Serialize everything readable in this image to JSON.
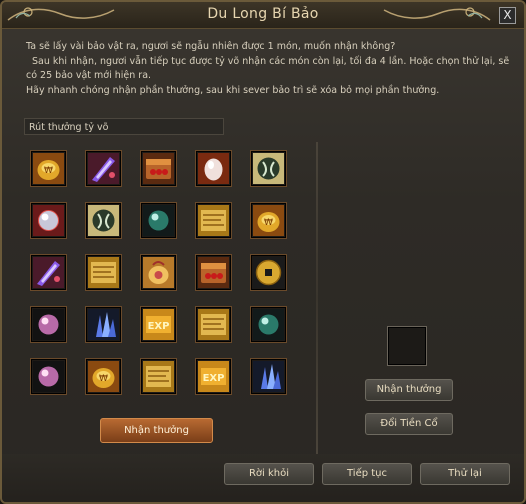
{
  "window": {
    "title": "Du Long Bí Bảo",
    "close_label": "X"
  },
  "description": {
    "line1": "Ta sẽ lấy vài bảo vật ra, ngươi sẽ ngẫu nhiên được 1 món, muốn nhận không?",
    "line2": "Sau khi nhận, ngươi vẫn tiếp tục được tỷ võ nhận các món còn lại, tối đa 4 lần. Hoặc chọn thử lại, sẽ",
    "line3": "có 25 bảo vật mới hiện ra.",
    "line4": "Hãy nhanh chóng nhận phần thưởng, sau khi sever bảo trì sẽ xóa bỏ mọi phần thưởng."
  },
  "reward_panel": {
    "header": "Rút thưởng tỷ võ",
    "rows": [
      [
        "gold-ingot-bag-icon",
        "purple-crystal-shard-icon",
        "treasure-chest-icon",
        "egg-icon",
        "jade-emblem-icon"
      ],
      [
        "pearl-orb-icon",
        "jade-emblem-icon",
        "teal-orb-icon",
        "gold-scroll-icon",
        "gold-ingot-bag-icon"
      ],
      [
        "purple-crystal-shard-icon",
        "gold-scroll-icon",
        "gold-bag-icon",
        "treasure-chest-icon",
        "coin-icon"
      ],
      [
        "pink-orb-icon",
        "blue-crystal-icon",
        "exp-book-icon",
        "gold-scroll-icon",
        "teal-orb-icon"
      ],
      [
        "pink-orb-icon",
        "gold-ingot-bag-icon",
        "gold-scroll-icon",
        "exp-book-icon",
        "blue-crystal-icon"
      ]
    ]
  },
  "buttons": {
    "claim_main": "Nhận thưởng",
    "claim_side": "Nhận thưởng",
    "exchange": "Đổi Tiền Cổ",
    "leave": "Rời khỏi",
    "continue": "Tiếp tục",
    "retry": "Thử lại"
  },
  "colors": {
    "accent_orange": "#b86a32",
    "frame_gold": "#6b5a3a",
    "text": "#d8d0bd"
  }
}
